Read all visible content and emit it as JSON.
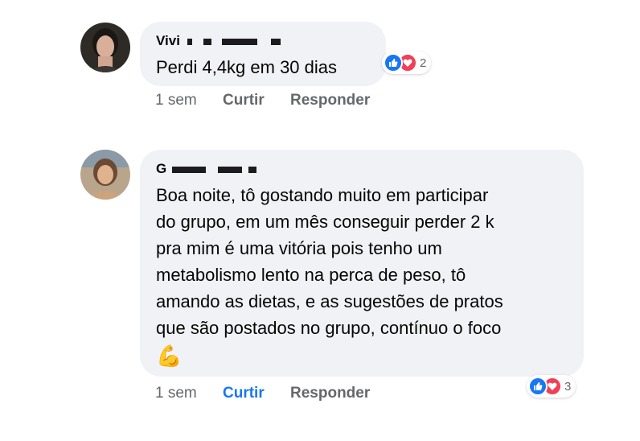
{
  "comments": [
    {
      "author": "Vivi",
      "text": "Perdi 4,4kg em 30 dias",
      "reaction_count": "2",
      "time": "1 sem",
      "like_label": "Curtir",
      "reply_label": "Responder",
      "liked": false
    },
    {
      "author": "G",
      "text": "Boa noite, tô gostando muito em participar\ndo grupo, em um mês conseguir perder 2 k\npra mim é uma vitória pois tenho um\nmetabolismo lento na perca de peso, tô\namando as dietas, e as sugestões de pratos\nque são postados no grupo, contínuo o foco",
      "emoji": "💪",
      "reaction_count": "3",
      "time": "1 sem",
      "like_label": "Curtir",
      "reply_label": "Responder",
      "liked": true
    }
  ],
  "colors": {
    "bubble": "#f0f2f5",
    "like_blue": "#1877f2",
    "love_red": "#f33e58",
    "meta_gray": "#65676b"
  }
}
